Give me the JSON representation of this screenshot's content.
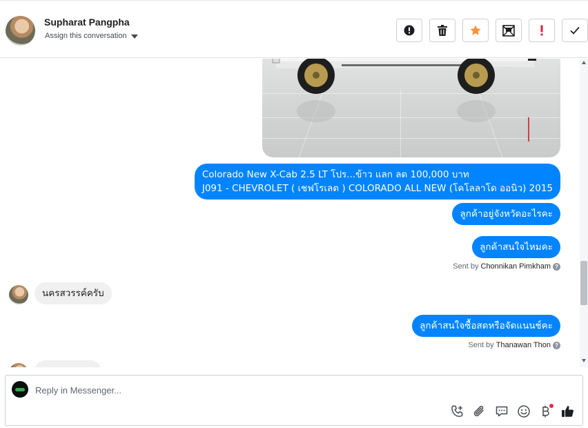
{
  "header": {
    "contact_name": "Supharat Pangpha",
    "assign_label": "Assign this conversation",
    "actions": [
      {
        "icon": "alert-circle-icon",
        "label": "Mark as spam"
      },
      {
        "icon": "trash-icon",
        "label": "Delete"
      },
      {
        "icon": "star-icon",
        "label": "Star"
      },
      {
        "icon": "mark-unread-icon",
        "label": "Mark as unread"
      },
      {
        "icon": "exclamation-icon",
        "label": "Follow up"
      },
      {
        "icon": "check-icon",
        "label": "Mark as done"
      }
    ],
    "accent_star": "#f7923b",
    "accent_alert": "#e41e3f"
  },
  "thread": {
    "messages": [
      {
        "from": "page",
        "lines": [
          "Colorado New X-Cab 2.5 LT โปร...ข้าว แลก ลด 100,000 บาท",
          "J091 - CHEVROLET ( เชฟโรเลต ) COLORADO ALL NEW (โคโลลาโด ออนิว) 2015"
        ]
      },
      {
        "from": "page",
        "text": "ลูกค้าอยู่จังหวัดอะไรคะ"
      },
      {
        "from": "page",
        "text": "ลูกค้าสนใจไหมคะ"
      },
      {
        "sent_by_prefix": "Sent by",
        "sent_by_name": "Chonnikan Pimkham"
      },
      {
        "from": "customer",
        "text": "นครสวรรค์ครับ"
      },
      {
        "from": "page",
        "text": "ลูกค้าสนใจซื้อสดหรือจัดแนนช์คะ"
      },
      {
        "sent_by_prefix": "Sent by",
        "sent_by_name": "Thanawan Thon"
      }
    ],
    "bubble_color": "#0084ff"
  },
  "composer": {
    "placeholder": "Reply in Messenger...",
    "tools": [
      "phone-plus-icon",
      "paperclip-icon",
      "saved-reply-icon",
      "emoji-icon",
      "baht-payment-icon",
      "like-icon"
    ]
  }
}
